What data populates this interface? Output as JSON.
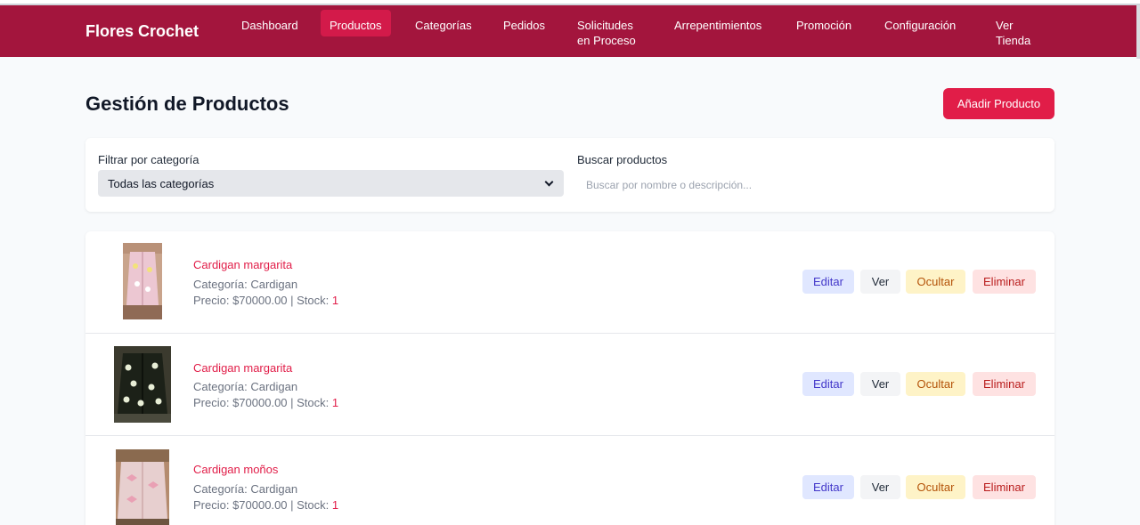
{
  "app": {
    "brand": "Flores Crochet"
  },
  "nav": {
    "items": [
      {
        "line1": "Dashboard",
        "line2": ""
      },
      {
        "line1": "Productos",
        "line2": ""
      },
      {
        "line1": "Categorías",
        "line2": ""
      },
      {
        "line1": "Pedidos",
        "line2": ""
      },
      {
        "line1": "Solicitudes",
        "line2": "en Proceso"
      },
      {
        "line1": "Arrepentimientos",
        "line2": ""
      },
      {
        "line1": "Promoción",
        "line2": ""
      },
      {
        "line1": "Configuración",
        "line2": ""
      },
      {
        "line1": "Ver",
        "line2": "Tienda"
      }
    ],
    "active_index": 1
  },
  "page": {
    "title": "Gestión de Productos",
    "add_button": "Añadir Producto"
  },
  "filters": {
    "category_label": "Filtrar por categoría",
    "category_selected": "Todas las categorías",
    "search_label": "Buscar productos",
    "search_placeholder": "Buscar por nombre o descripción...",
    "search_value": ""
  },
  "labels": {
    "category_prefix": "Categoría: ",
    "price_prefix": "Precio: ",
    "stock_sep": " | Stock: "
  },
  "actions": {
    "edit": "Editar",
    "view": "Ver",
    "hide": "Ocultar",
    "delete": "Eliminar"
  },
  "products": [
    {
      "name": "Cardigan margarita",
      "category": "Cardigan",
      "price": "$70000.00",
      "stock": "1"
    },
    {
      "name": "Cardigan margarita",
      "category": "Cardigan",
      "price": "$70000.00",
      "stock": "1"
    },
    {
      "name": "Cardigan moños",
      "category": "Cardigan",
      "price": "$70000.00",
      "stock": "1"
    }
  ],
  "colors": {
    "navbar": "#a3153d",
    "accent": "#e11d48",
    "active_nav": "#d31a4a"
  }
}
